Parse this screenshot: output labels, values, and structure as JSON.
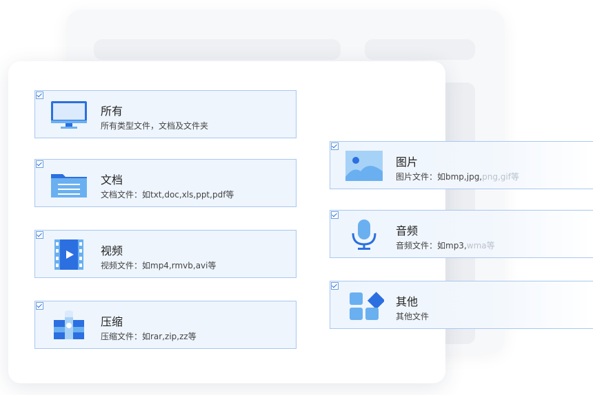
{
  "categories": [
    {
      "id": "all",
      "title": "所有",
      "desc": "所有类型文件，文档及文件夹",
      "checked": true,
      "icon": "monitor-icon"
    },
    {
      "id": "doc",
      "title": "文档",
      "desc": "文档文件：如txt,doc,xls,ppt,pdf等",
      "checked": true,
      "icon": "folder-icon"
    },
    {
      "id": "video",
      "title": "视频",
      "desc": "视频文件：如mp4,rmvb,avi等",
      "checked": true,
      "icon": "film-icon"
    },
    {
      "id": "zip",
      "title": "压缩",
      "desc": "压缩文件：如rar,zip,zz等",
      "checked": true,
      "icon": "archive-icon"
    },
    {
      "id": "image",
      "title": "图片",
      "desc_main": "图片文件：如bmp,jpg,",
      "desc_fade": "png,gif等",
      "checked": true,
      "icon": "image-icon"
    },
    {
      "id": "audio",
      "title": "音频",
      "desc_main": "音频文件：如mp3,",
      "desc_fade": "wma等",
      "checked": true,
      "icon": "microphone-icon"
    },
    {
      "id": "other",
      "title": "其他",
      "desc": "其他文件",
      "checked": true,
      "icon": "apps-icon"
    }
  ],
  "colors": {
    "accent": "#2b6fe0",
    "light": "#6ab0f0",
    "item_bg": "#eef5fd",
    "border": "#a9c7ee"
  }
}
